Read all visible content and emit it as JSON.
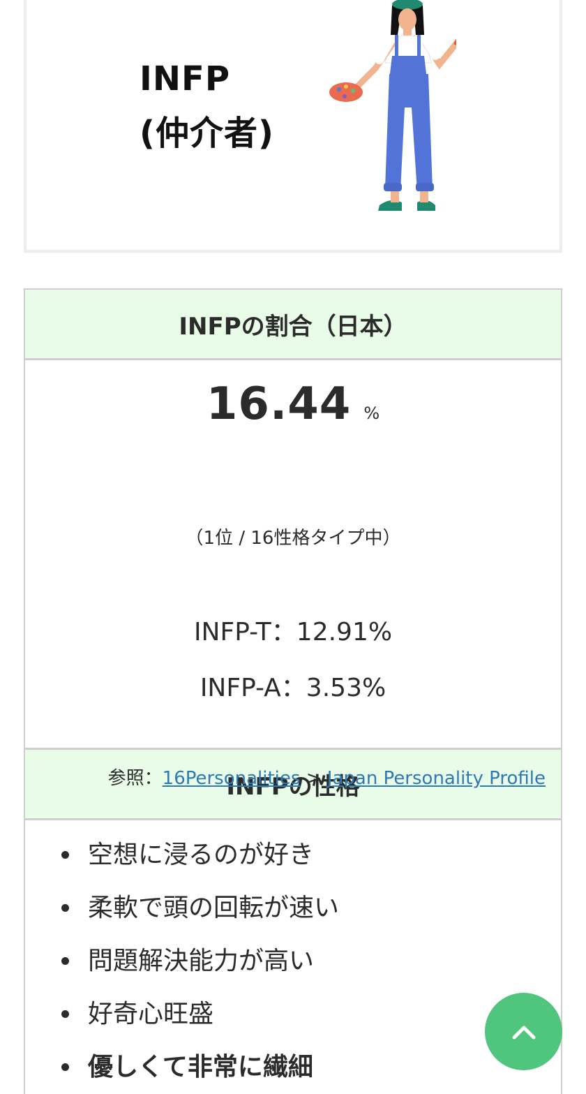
{
  "hero": {
    "type_code": "INFP",
    "type_name": "(仲介者)"
  },
  "ratio_section": {
    "heading": "INFPの割合（日本）",
    "percentage": "16.44",
    "percent_unit": "%",
    "rank_text": "（1位 / 16性格タイプ中）",
    "turbulent": "INFP-T：12.91%",
    "assertive": "INFP-A：3.53%",
    "source_prefix": "参照：",
    "source_link_1": "16Personalities",
    "source_separator": " > ",
    "source_link_2": "Japan Personality Profile"
  },
  "traits_section": {
    "heading": "INFPの性格",
    "items": [
      "空想に浸るのが好き",
      "柔軟で頭の回転が速い",
      "問題解決能力が高い",
      "好奇心旺盛",
      "優しくて非常に繊細"
    ]
  },
  "colors": {
    "section_header_bg": "#e8fce8",
    "link": "#2e79b6",
    "back_to_top": "#4fc57d"
  },
  "icons": {
    "back_to_top": "chevron-up-icon",
    "illustration": "painter-illustration"
  }
}
